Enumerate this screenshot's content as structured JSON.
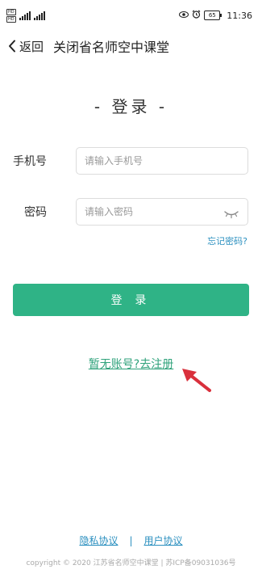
{
  "status_bar": {
    "sim1": "HD",
    "sim2": "HD",
    "battery": "65",
    "time": "11:36"
  },
  "header": {
    "back_label": "返回",
    "title": "关闭省名师空中课堂"
  },
  "login": {
    "heading": "- 登录 -",
    "phone_label": "手机号",
    "phone_placeholder": "请输入手机号",
    "password_label": "密码",
    "password_placeholder": "请输入密码",
    "forgot_password": "忘记密码?",
    "submit": "登 录",
    "register_link": "暂无账号?去注册"
  },
  "footer": {
    "privacy": "隐私协议",
    "separator": "|",
    "user_agreement": "用户协议",
    "copyright": "copyright © 2020 江苏省名师空中课堂 | 苏ICP备09031036号"
  },
  "colors": {
    "accent_green": "#2fb386",
    "link_blue": "#2a8fbf",
    "annotation_red": "#d9303c"
  }
}
